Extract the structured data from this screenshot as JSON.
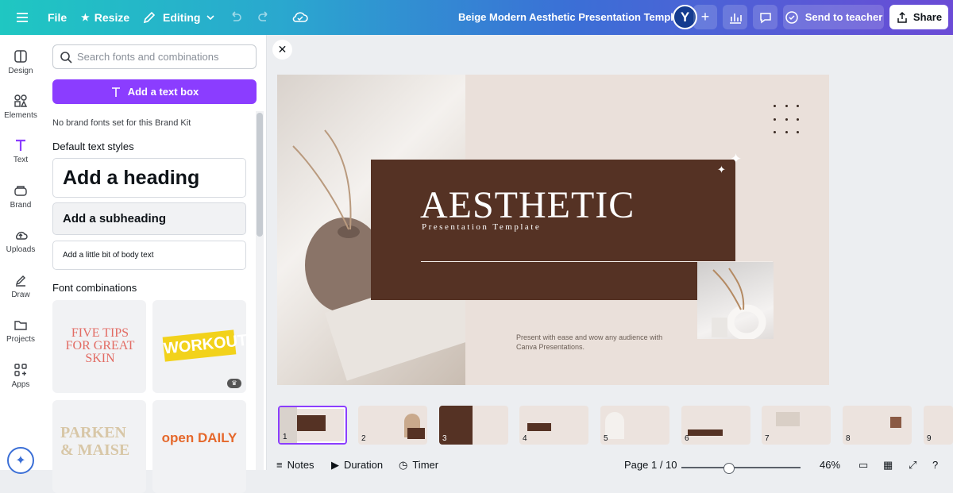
{
  "topbar": {
    "file": "File",
    "resize": "Resize",
    "editing": "Editing",
    "title": "Beige Modern Aesthetic Presentation Template",
    "avatar": "Y",
    "send": "Send to teacher",
    "share": "Share"
  },
  "rail": [
    {
      "label": "Design",
      "icon": "design-icon"
    },
    {
      "label": "Elements",
      "icon": "elements-icon"
    },
    {
      "label": "Text",
      "icon": "text-icon"
    },
    {
      "label": "Brand",
      "icon": "brand-icon"
    },
    {
      "label": "Uploads",
      "icon": "uploads-icon"
    },
    {
      "label": "Draw",
      "icon": "draw-icon"
    },
    {
      "label": "Projects",
      "icon": "projects-icon"
    },
    {
      "label": "Apps",
      "icon": "apps-icon"
    }
  ],
  "panel": {
    "search_placeholder": "Search fonts and combinations",
    "add_text": "Add a text box",
    "brand_note": "No brand fonts set for this Brand Kit",
    "default_styles": "Default text styles",
    "heading": "Add a heading",
    "subheading": "Add a subheading",
    "body": "Add a little bit of body text",
    "combos": "Font combinations",
    "tiles": [
      "FIVE TIPS FOR GREAT SKIN",
      "WORKOUT",
      "PARKEN & MAISE",
      "open DAILY"
    ]
  },
  "slide": {
    "title": "AESTHETIC",
    "subtitle": "Presentation Template",
    "description": "Present with ease and wow any audience with Canva Presentations."
  },
  "thumbnails": [
    "1",
    "2",
    "3",
    "4",
    "5",
    "6",
    "7",
    "8",
    "9"
  ],
  "bottombar": {
    "notes": "Notes",
    "duration": "Duration",
    "timer": "Timer",
    "page": "Page 1 / 10",
    "zoom": "46%"
  },
  "colors": {
    "accent": "#8b3dff",
    "slide_bg": "#eae0da",
    "slide_box": "#553224"
  }
}
